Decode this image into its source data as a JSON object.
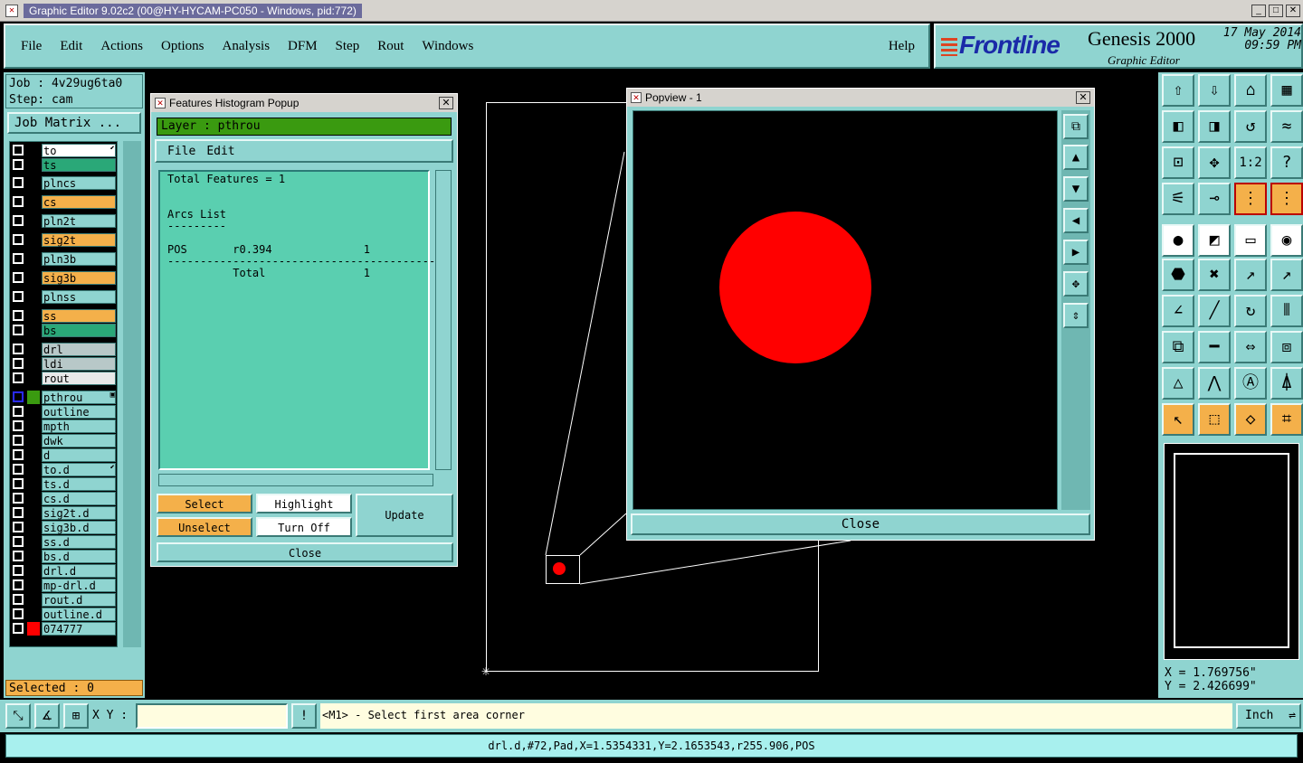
{
  "window": {
    "title": "Graphic Editor 9.02c2 (00@HY-HYCAM-PC050 - Windows, pid:772)"
  },
  "menu": {
    "items": [
      "File",
      "Edit",
      "Actions",
      "Options",
      "Analysis",
      "DFM",
      "Step",
      "Rout",
      "Windows"
    ],
    "help": "Help"
  },
  "brand": {
    "logo": "Frontline",
    "product": "Genesis 2000",
    "subtitle": "Graphic Editor",
    "date": "17 May 2014",
    "time": "09:59 PM"
  },
  "job": {
    "job_line": "Job : 4v29ug6ta0",
    "step_line": "Step: cam",
    "matrix_button": "Job Matrix ..."
  },
  "layers": [
    {
      "name": "to",
      "color": "#ffffff",
      "mark": "⬋"
    },
    {
      "name": "ts",
      "color": "#2aa878",
      "mark": ""
    },
    {
      "name": "plncs",
      "color": "#8fd4d0",
      "mark": ""
    },
    {
      "name": "cs",
      "color": "#f4b04a",
      "mark": ""
    },
    {
      "name": "pln2t",
      "color": "#8fd4d0",
      "mark": ""
    },
    {
      "name": "sig2t",
      "color": "#f4b04a",
      "mark": ""
    },
    {
      "name": "pln3b",
      "color": "#8fd4d0",
      "mark": ""
    },
    {
      "name": "sig3b",
      "color": "#f4b04a",
      "mark": ""
    },
    {
      "name": "plnss",
      "color": "#8fd4d0",
      "mark": ""
    },
    {
      "name": "ss",
      "color": "#f4b04a",
      "mark": ""
    },
    {
      "name": "bs",
      "color": "#2aa878",
      "mark": ""
    },
    {
      "name": "drl",
      "color": "#b8c8c8",
      "mark": ""
    },
    {
      "name": "ldi",
      "color": "#b8c8c8",
      "mark": ""
    },
    {
      "name": "rout",
      "color": "#e8e8e8",
      "mark": ""
    },
    {
      "name": "pthrou",
      "color": "#8fd4d0",
      "mark": "▣"
    },
    {
      "name": "outline",
      "color": "#8fd4d0",
      "mark": ""
    },
    {
      "name": "mpth",
      "color": "#8fd4d0",
      "mark": ""
    },
    {
      "name": "dwk",
      "color": "#8fd4d0",
      "mark": ""
    },
    {
      "name": "d",
      "color": "#8fd4d0",
      "mark": ""
    },
    {
      "name": "to.d",
      "color": "#8fd4d0",
      "mark": "⬋"
    },
    {
      "name": "ts.d",
      "color": "#8fd4d0",
      "mark": ""
    },
    {
      "name": "cs.d",
      "color": "#8fd4d0",
      "mark": ""
    },
    {
      "name": "sig2t.d",
      "color": "#8fd4d0",
      "mark": ""
    },
    {
      "name": "sig3b.d",
      "color": "#8fd4d0",
      "mark": ""
    },
    {
      "name": "ss.d",
      "color": "#8fd4d0",
      "mark": ""
    },
    {
      "name": "bs.d",
      "color": "#8fd4d0",
      "mark": ""
    },
    {
      "name": "drl.d",
      "color": "#8fd4d0",
      "mark": ""
    },
    {
      "name": "mp-drl.d",
      "color": "#8fd4d0",
      "mark": ""
    },
    {
      "name": "rout.d",
      "color": "#8fd4d0",
      "mark": ""
    },
    {
      "name": "outline.d",
      "color": "#8fd4d0",
      "mark": ""
    },
    {
      "name": "074777",
      "color": "#8fd4d0",
      "mark": ""
    }
  ],
  "selected": "Selected : 0",
  "histogram": {
    "title": "Features Histogram Popup",
    "layer": "Layer :  pthrou",
    "menu": [
      "File",
      "Edit"
    ],
    "body": "Total Features = 1\n\n\nArcs List\n---------\n\nPOS       r0.394              1\n-----------------------------------------\n          Total               1",
    "select": "Select",
    "highlight": "Highlight",
    "unselect": "Unselect",
    "turn_off": "Turn Off",
    "update": "Update",
    "close": "Close"
  },
  "popview": {
    "title": "Popview - 1",
    "close": "Close"
  },
  "coords": {
    "x": "X = 1.769756\"",
    "y": "Y = 2.426699\""
  },
  "bottom": {
    "xy_label": "X Y :",
    "xy_value": "",
    "prompt": "<M1> - Select first area corner",
    "unit": "Inch"
  },
  "status": "drl.d,#72,Pad,X=1.5354331,Y=2.1653543,r255.906,POS",
  "colors": {
    "panel": "#8fd4d0",
    "accent_orange": "#f4b04a",
    "feature_red": "#ff0000",
    "layer_green": "#3a9a10"
  }
}
